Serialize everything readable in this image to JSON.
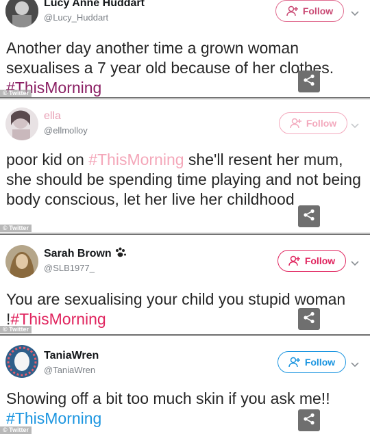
{
  "tweets": [
    {
      "name": "Lucy Anne Huddart",
      "handle": "@Lucy_Huddart",
      "follow_label": "Follow",
      "text": "Another day another time a grown woman sexualises a 7 year old because of her clothes. ",
      "hashtag": "#ThisMorning",
      "source": "© Twitter"
    },
    {
      "name": "ella",
      "handle": "@ellmolloy",
      "follow_label": "Follow",
      "text_before": "poor kid on ",
      "hashtag": "#ThisMorning",
      "text_after": " she'll resent her mum, she should be spending time playing and not being body conscious, let her live her childhood",
      "source": "© Twitter"
    },
    {
      "name": "Sarah Brown",
      "handle": "@SLB1977_",
      "follow_label": "Follow",
      "text": "You are sexualising your child you stupid woman !",
      "hashtag": "#ThisMorning",
      "source": "© Twitter"
    },
    {
      "name": "TaniaWren",
      "handle": "@TaniaWren",
      "follow_label": "Follow",
      "text": "Showing off a bit too much skin if you ask me!! ",
      "hashtag": "#ThisMorning",
      "source": "© Twitter"
    }
  ],
  "colors": {
    "follow_pink": "#e0245e",
    "follow_pale": "#f3a9bd",
    "follow_blue": "#1b95e0",
    "hashtag_purple": "#8a1f63",
    "share_bg": "#6f6f6f"
  },
  "icons": {
    "follow": "add-user-icon",
    "menu": "chevron-down-icon",
    "share": "share-icon",
    "badge": "paw-icon"
  }
}
